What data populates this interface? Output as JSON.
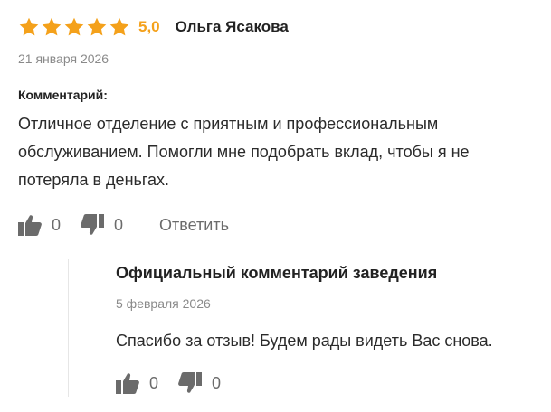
{
  "review": {
    "rating": 5,
    "rating_label": "5,0",
    "author": "Ольга Ясакова",
    "date": "21 января 2026",
    "comment_label": "Комментарий:",
    "comment_text": "Отличное отделение с приятным и профессиональным обслуживанием. Помогли мне подобрать вклад, чтобы я не потеряла в деньгах.",
    "likes": "0",
    "dislikes": "0",
    "reply_label": "Ответить"
  },
  "official_reply": {
    "title": "Официальный комментарий заведения",
    "date": "5 февраля 2026",
    "text": "Спасибо за отзыв! Будем рады видеть Вас снова.",
    "likes": "0",
    "dislikes": "0"
  },
  "colors": {
    "star": "#f4a11b",
    "icon": "#6b6b6b",
    "muted_text": "#8a8a8a"
  },
  "icons": {
    "star": "star-icon",
    "like": "thumbs-up-icon",
    "dislike": "thumbs-down-icon"
  }
}
